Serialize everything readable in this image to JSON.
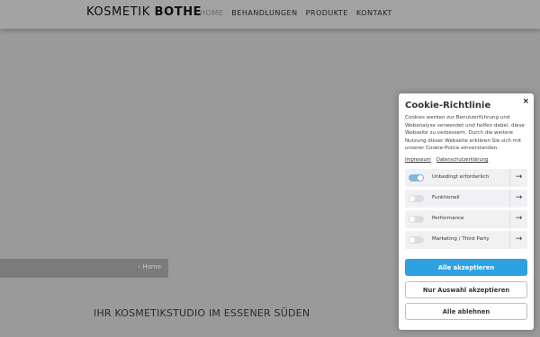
{
  "header": {
    "logo_light": "KOSMETIK",
    "logo_bold": "BOTHE",
    "nav": [
      "HOME",
      "BEHANDLUNGEN",
      "PRODUKTE",
      "KONTAKT"
    ]
  },
  "breadcrumb": {
    "current": "Home"
  },
  "tagline": "IHR KOSMETIKSTUDIO IM ESSENER SÜDEN",
  "cookie": {
    "title": "Cookie-Richtlinie",
    "close": "×",
    "text": "Cookies werden zur Benutzerführung und Webanalyse verwendet und helfen dabei, diese Webseite zu verbessern. Durch die weitere Nutzung dieser Webseite erklären Sie sich mit unserer Cookie-Police einverstanden.",
    "links": [
      "Impressum",
      "Datenschutzerklärung"
    ],
    "options": [
      {
        "label": "Unbedingt erforderlich",
        "enabled": true
      },
      {
        "label": "Funktionell",
        "enabled": false
      },
      {
        "label": "Performance",
        "enabled": false
      },
      {
        "label": "Marketing / Third Party",
        "enabled": false
      }
    ],
    "arrow": "→",
    "buttons": {
      "accept_all": "Alle akzeptieren",
      "accept_selection": "Nur Auswahl akzeptieren",
      "reject_all": "Alle ablehnen"
    }
  }
}
